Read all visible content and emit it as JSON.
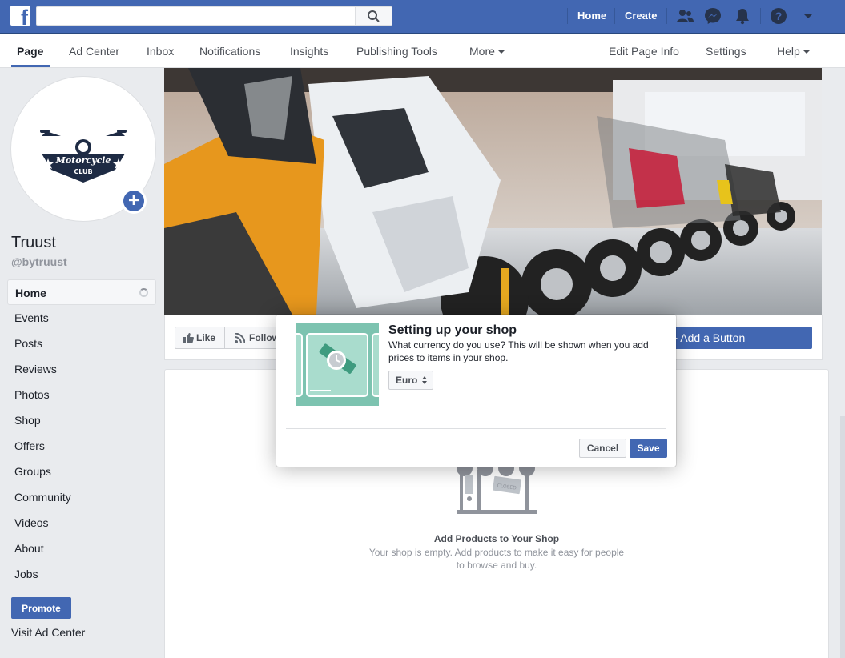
{
  "topbar": {
    "search_placeholder": "",
    "home_label": "Home",
    "create_label": "Create"
  },
  "subnav": {
    "page": "Page",
    "ad_center": "Ad Center",
    "inbox": "Inbox",
    "notifications": "Notifications",
    "insights": "Insights",
    "publishing_tools": "Publishing Tools",
    "more": "More",
    "edit_page_info": "Edit Page Info",
    "settings": "Settings",
    "help": "Help"
  },
  "profile": {
    "logo_text_top": "Motorcycle",
    "logo_text_bottom": "CLUB",
    "name": "Truust",
    "handle": "@bytruust"
  },
  "left_nav": {
    "items": [
      {
        "label": "Home",
        "active": true
      },
      {
        "label": "Events"
      },
      {
        "label": "Posts"
      },
      {
        "label": "Reviews"
      },
      {
        "label": "Photos"
      },
      {
        "label": "Shop"
      },
      {
        "label": "Offers"
      },
      {
        "label": "Groups"
      },
      {
        "label": "Community"
      },
      {
        "label": "Videos"
      },
      {
        "label": "About"
      },
      {
        "label": "Jobs"
      }
    ],
    "promote": "Promote",
    "visit_ad_center": "Visit Ad Center"
  },
  "actions": {
    "like": "Like",
    "follow": "Follow",
    "add_button": "+ Add a Button"
  },
  "shop": {
    "sign_text": "CLOSED",
    "title": "Add Products to Your Shop",
    "description": "Your shop is empty. Add products to make it easy for people to browse and buy."
  },
  "modal": {
    "title": "Setting up your shop",
    "description": "What currency do you use? This will be shown when you add prices to items in your shop.",
    "currency": "Euro",
    "cancel": "Cancel",
    "save": "Save"
  },
  "colors": {
    "brand_blue": "#4267b2",
    "background": "#e9ebee",
    "illustration_green": "#7dc3b0"
  }
}
